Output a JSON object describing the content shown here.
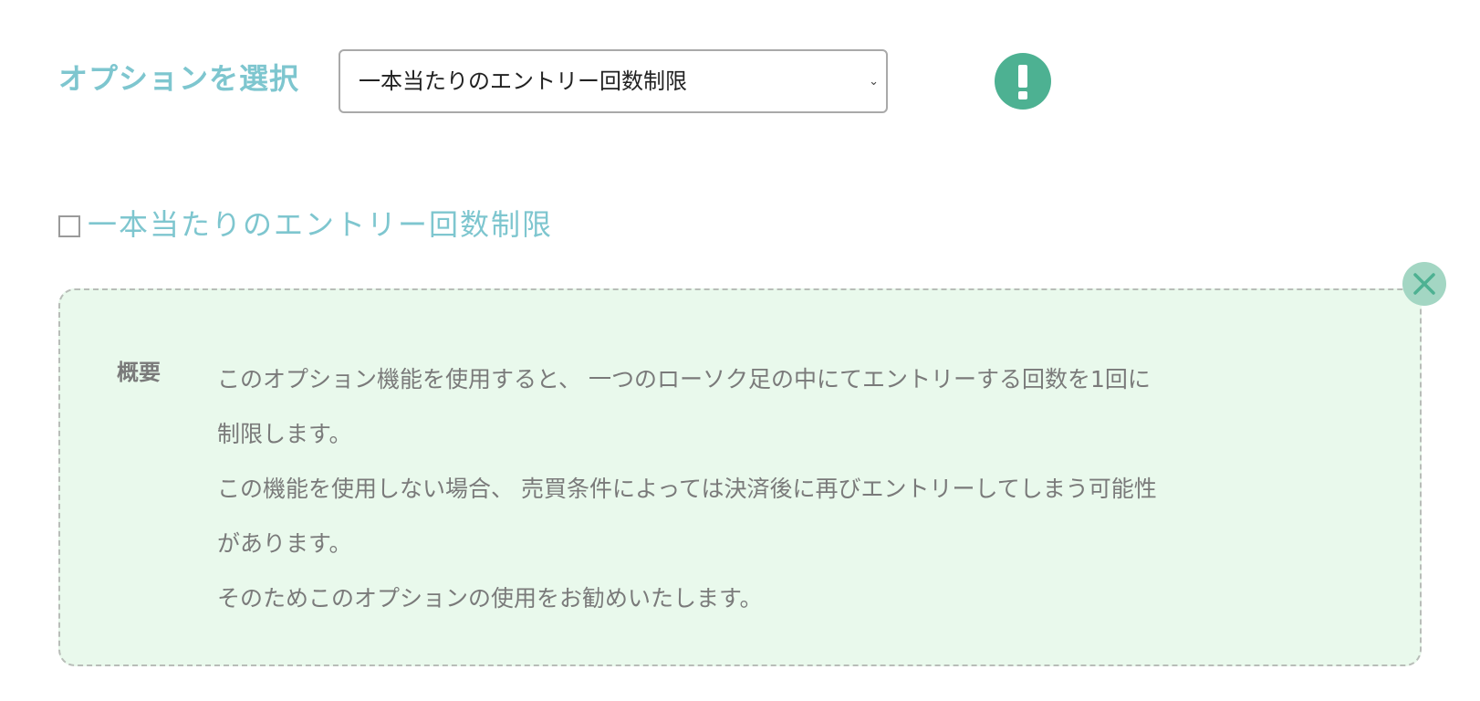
{
  "option_selector": {
    "label": "オプションを選択",
    "selected_value": "一本当たりのエントリー回数制限",
    "chevron_icon": "chevron-down-icon"
  },
  "alert": {
    "icon": "exclamation-icon",
    "color": "#4db192"
  },
  "option": {
    "checked": false,
    "label": "一本当たりのエントリー回数制限"
  },
  "info_panel": {
    "background": "#e9f9ec",
    "heading": "概要",
    "lines": [
      "このオプション機能を使用すると、 一つのローソク足の中にてエントリーする回数を1回に",
      "制限します。",
      "この機能を使用しない場合、 売買条件によっては決済後に再びエントリーしてしまう可能性",
      "があります。",
      "そのためこのオプションの使用をお勧めいたします。"
    ],
    "close_icon": "close-icon"
  },
  "colors": {
    "accent": "#7ec6cf",
    "alert_green": "#4db192",
    "close_bg": "#a3d6c3",
    "body_text": "#7a7a7a"
  }
}
